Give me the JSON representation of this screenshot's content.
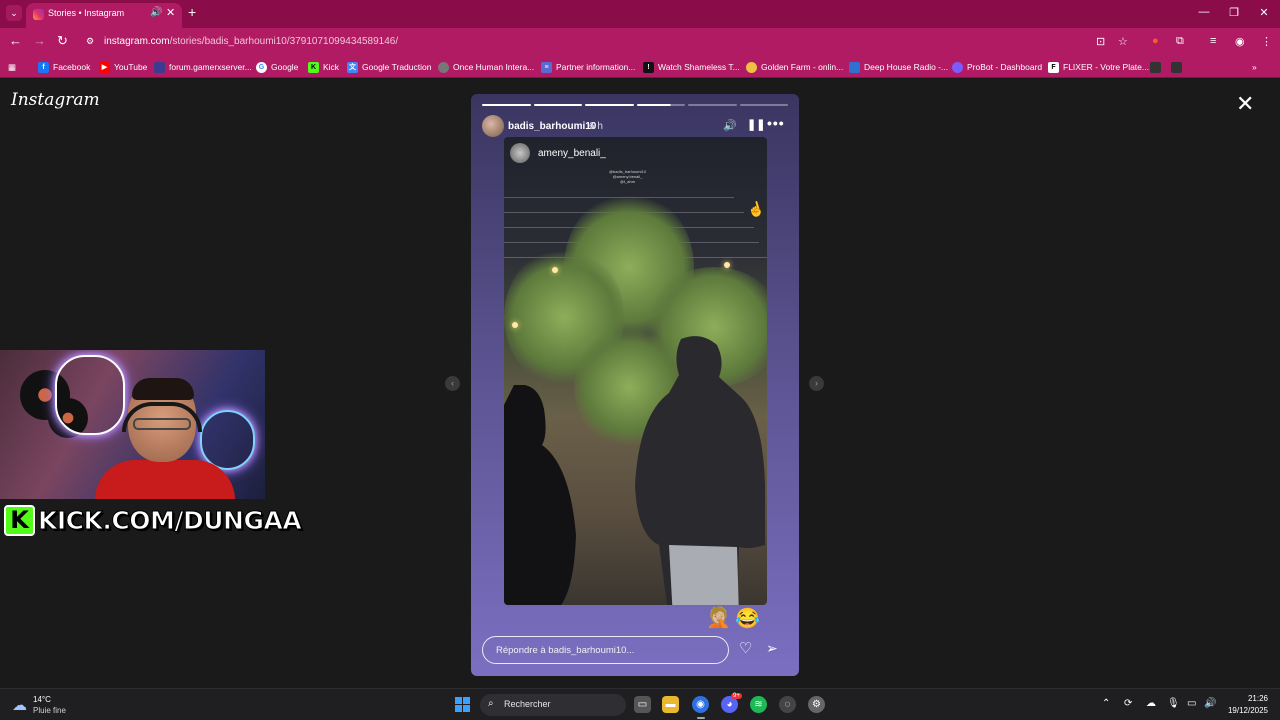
{
  "browser": {
    "tab_title": "Stories • Instagram",
    "url_domain": "instagram.com",
    "url_path": "/stories/badis_barhoumi10/3791071099434589146/",
    "bookmarks": [
      {
        "label": "Facebook",
        "icon": "facebook-icon",
        "color": "#1877f2"
      },
      {
        "label": "YouTube",
        "icon": "youtube-icon",
        "color": "#ff0000"
      },
      {
        "label": "forum.gamerxserver...",
        "icon": "forum-icon",
        "color": "#3b3b8f"
      },
      {
        "label": "Google",
        "icon": "google-icon",
        "color": "#ffffff"
      },
      {
        "label": "Kick",
        "icon": "kick-icon",
        "color": "#53fc18"
      },
      {
        "label": "Google Traduction",
        "icon": "translate-icon",
        "color": "#4285f4"
      },
      {
        "label": "Once Human Intera...",
        "icon": "once-human-icon",
        "color": "#777777"
      },
      {
        "label": "Partner information...",
        "icon": "list-icon",
        "color": "#5b6ad0"
      },
      {
        "label": "Watch Shameless T...",
        "icon": "shameless-icon",
        "color": "#111111"
      },
      {
        "label": "Golden Farm - onlin...",
        "icon": "golden-farm-icon",
        "color": "#f0c040"
      },
      {
        "label": "Deep House Radio -...",
        "icon": "radio-icon",
        "color": "#3070d0"
      },
      {
        "label": "ProBot - Dashboard",
        "icon": "probot-icon",
        "color": "#7a5cff"
      },
      {
        "label": "FLIXER - Votre Plate...",
        "icon": "flixer-icon",
        "color": "#ffffff"
      }
    ]
  },
  "page": {
    "logo": "Instagram",
    "story": {
      "username": "badis_barhoumi10",
      "time": "6 h",
      "shared_username": "ameny_benali_",
      "mention_lines": [
        "@badis_barhoumi10",
        "@ameny.benali_",
        "@t_ahm"
      ],
      "reply_placeholder": "Répondre à badis_barhoumi10...",
      "reactions": [
        "🤦🏼",
        "😂"
      ],
      "progress": {
        "total_segments": 6,
        "completed": 3,
        "current_fraction": 0.7
      }
    }
  },
  "overlay": {
    "kick_logo": "K",
    "kick_text": "KICK.COM/DUNGAA",
    "kick_color": "#53fc18"
  },
  "taskbar": {
    "weather_temp": "14°C",
    "weather_desc": "Pluie fine",
    "search_label": "Rechercher",
    "time": "21:26",
    "date": "19/12/2025",
    "discord_badge": "9+"
  },
  "colors": {
    "chrome_theme": "#b01b63",
    "tabbar": "#8a0d4a",
    "page_bg": "#1a1a1a"
  }
}
